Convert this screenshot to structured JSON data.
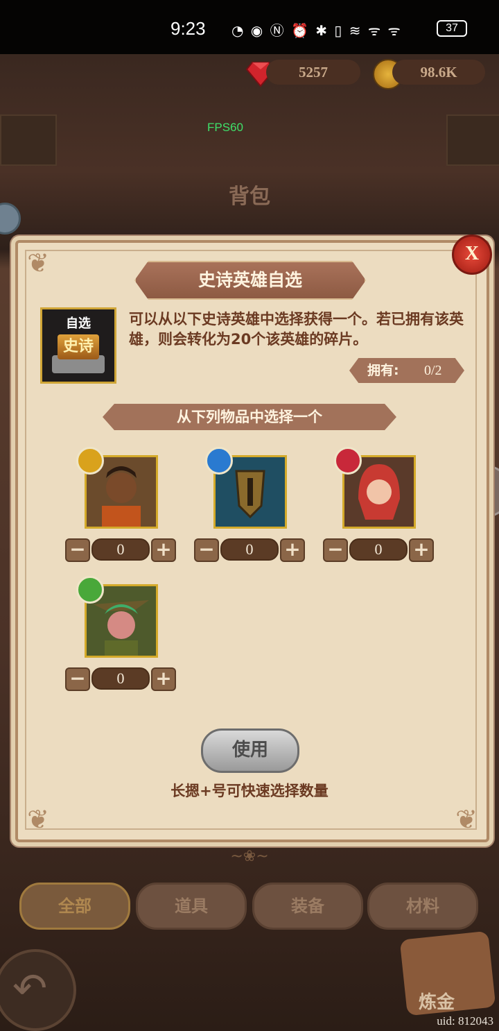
{
  "status_bar": {
    "time": "9:23",
    "icons": "◔ ◉ Ⓝ ⏰ ✱ ▯ ≋ ᯤ ᯤ",
    "battery": "37"
  },
  "currency": {
    "gems": "5257",
    "gold": "98.6K"
  },
  "fps": "FPS60",
  "bag_title": "背包",
  "popup": {
    "title": "史诗英雄自选",
    "item_icon": {
      "top_label": "自选",
      "rarity_label": "史诗"
    },
    "description": "可以从以下史诗英雄中选择获得一个。若已拥有该英雄，则会转化为20个该英雄的碎片。",
    "owned_label": "拥有:",
    "owned_value": "0/2",
    "choose_label": "从下列物品中选择一个",
    "close_label": "X",
    "heroes": [
      {
        "element": "light",
        "badge_color": "#d9a21c",
        "quantity": "0",
        "minus": "−",
        "plus": "+"
      },
      {
        "element": "water",
        "badge_color": "#2a7ad0",
        "quantity": "0",
        "minus": "−",
        "plus": "+"
      },
      {
        "element": "fire",
        "badge_color": "#c8283a",
        "quantity": "0",
        "minus": "−",
        "plus": "+"
      },
      {
        "element": "nature",
        "badge_color": "#49a83a",
        "quantity": "0",
        "minus": "−",
        "plus": "+"
      }
    ],
    "use_button": "使用",
    "hint": "长摁+号可快速选择数量"
  },
  "tabs": [
    "全部",
    "道具",
    "装备",
    "材料"
  ],
  "alchemy_label": "炼金",
  "uid": "uid: 812043"
}
